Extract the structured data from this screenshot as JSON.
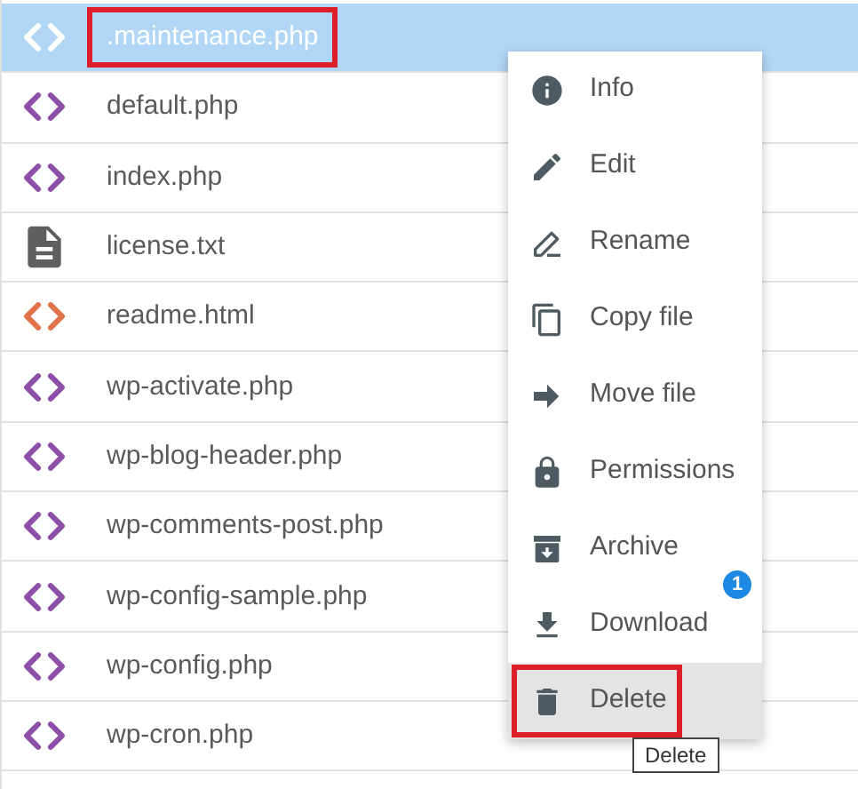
{
  "files": [
    {
      "name": ".maintenance.php",
      "kind": "code",
      "color": "#ffffff",
      "selected": true,
      "highlighted": true
    },
    {
      "name": "default.php",
      "kind": "code",
      "color": "#8e4fa8",
      "selected": false,
      "highlighted": false
    },
    {
      "name": "index.php",
      "kind": "code",
      "color": "#8e4fa8",
      "selected": false,
      "highlighted": false
    },
    {
      "name": "license.txt",
      "kind": "text",
      "color": "#5f5f5f",
      "selected": false,
      "highlighted": false
    },
    {
      "name": "readme.html",
      "kind": "code",
      "color": "#e0734a",
      "selected": false,
      "highlighted": false
    },
    {
      "name": "wp-activate.php",
      "kind": "code",
      "color": "#8e4fa8",
      "selected": false,
      "highlighted": false
    },
    {
      "name": "wp-blog-header.php",
      "kind": "code",
      "color": "#8e4fa8",
      "selected": false,
      "highlighted": false
    },
    {
      "name": "wp-comments-post.php",
      "kind": "code",
      "color": "#8e4fa8",
      "selected": false,
      "highlighted": false
    },
    {
      "name": "wp-config-sample.php",
      "kind": "code",
      "color": "#8e4fa8",
      "selected": false,
      "highlighted": false
    },
    {
      "name": "wp-config.php",
      "kind": "code",
      "color": "#8e4fa8",
      "selected": false,
      "highlighted": false
    },
    {
      "name": "wp-cron.php",
      "kind": "code",
      "color": "#8e4fa8",
      "selected": false,
      "highlighted": false
    }
  ],
  "context_menu": {
    "items": [
      {
        "label": "Info",
        "kind": "info",
        "hovered": false,
        "highlighted": false
      },
      {
        "label": "Edit",
        "kind": "edit",
        "hovered": false,
        "highlighted": false
      },
      {
        "label": "Rename",
        "kind": "rename",
        "hovered": false,
        "highlighted": false
      },
      {
        "label": "Copy file",
        "kind": "copy",
        "hovered": false,
        "highlighted": false
      },
      {
        "label": "Move file",
        "kind": "move",
        "hovered": false,
        "highlighted": false
      },
      {
        "label": "Permissions",
        "kind": "lock",
        "hovered": false,
        "highlighted": false
      },
      {
        "label": "Archive",
        "kind": "archive",
        "hovered": false,
        "highlighted": false
      },
      {
        "label": "Download",
        "kind": "download",
        "hovered": false,
        "highlighted": false,
        "badge": "1"
      },
      {
        "label": "Delete",
        "kind": "delete",
        "hovered": true,
        "highlighted": true
      }
    ]
  },
  "tooltip": "Delete"
}
